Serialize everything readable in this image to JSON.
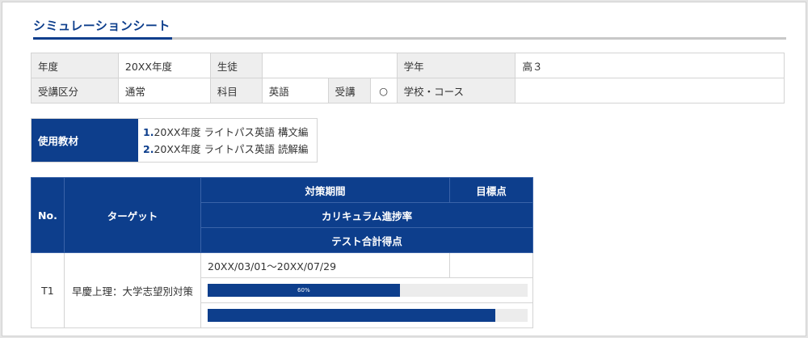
{
  "sheet_title": "シミュレーションシート",
  "info": {
    "year_label": "年度",
    "year_value": "20XX年度",
    "student_label": "生徒",
    "student_value": "",
    "grade_label": "学年",
    "grade_value": "高３",
    "course_type_label": "受講区分",
    "course_type_value": "通常",
    "subject_label": "科目",
    "subject_value": "英語",
    "attend_label": "受講",
    "attend_value": "○",
    "school_label": "学校・コース",
    "school_value": ""
  },
  "materials": {
    "label": "使用教材",
    "items": [
      {
        "num": "1.",
        "text": "20XX年度 ライトパス英語 構文編"
      },
      {
        "num": "2.",
        "text": "20XX年度 ライトパス英語 読解編"
      }
    ]
  },
  "target_table": {
    "headers": {
      "no": "No.",
      "target": "ターゲット",
      "period": "対策期間",
      "goal": "目標点",
      "progress": "カリキュラム進捗率",
      "test_total": "テスト合計得点"
    },
    "rows": [
      {
        "no": "T1",
        "target": "早慶上理：大学志望別対策",
        "period": "20XX/03/01～20XX/07/29",
        "goal": "",
        "progress_fraction": 0.6,
        "progress_label": "60%",
        "test_fraction": 0.9
      }
    ]
  },
  "colors": {
    "brand": "#0d3e8c",
    "label_bg": "#eeeeee",
    "bar_track": "#ececec"
  }
}
